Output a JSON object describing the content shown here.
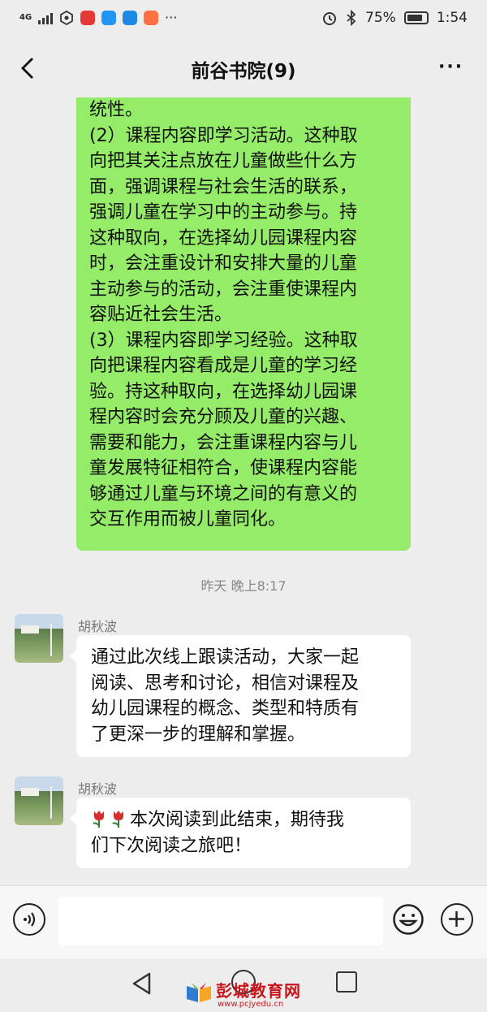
{
  "status_bar": {
    "network": "4G",
    "battery": "75%",
    "time": "1:54"
  },
  "header": {
    "title": "前谷书院(9)",
    "more_label": "···"
  },
  "messages": {
    "green_bubble_lines": [
      "统性。",
      "(2）课程内容即学习活动。这种取",
      "向把其关注点放在儿童做些什么方",
      "面，强调课程与社会生活的联系，",
      "强调儿童在学习中的主动参与。持",
      "这种取向，在选择幼儿园课程内容",
      "时，会注重设计和安排大量的儿童",
      "主动参与的活动，会注重使课程内",
      "容贴近社会生活。",
      "(3）课程内容即学习经验。这种取",
      "向把课程内容看成是儿童的学习经",
      "验。持这种取向，在选择幼儿园课",
      "程内容时会充分顾及儿童的兴趣、",
      "需要和能力，会注重课程内容与儿",
      "童发展特征相符合，使课程内容能",
      "够通过儿童与环境之间的有意义的",
      "交互作用而被儿童同化。"
    ],
    "timestamp": "昨天 晚上8:17",
    "msg1": {
      "sender": "胡秋波",
      "lines": [
        "通过此次线上跟读活动，大家一起",
        "阅读、思考和讨论，相信对课程及",
        "幼儿园课程的概念、类型和特质有",
        "了更深一步的理解和掌握。"
      ]
    },
    "msg2": {
      "sender": "胡秋波",
      "line1": "本次阅读到此结束，期待我",
      "line2": "们下次阅读之旅吧！"
    }
  },
  "watermark": {
    "name": "彭城教育网",
    "url": "www.pcjyedu.cn"
  },
  "colors": {
    "green_bubble": "#95ec69",
    "background": "#ededed",
    "watermark": "#c8161d"
  }
}
